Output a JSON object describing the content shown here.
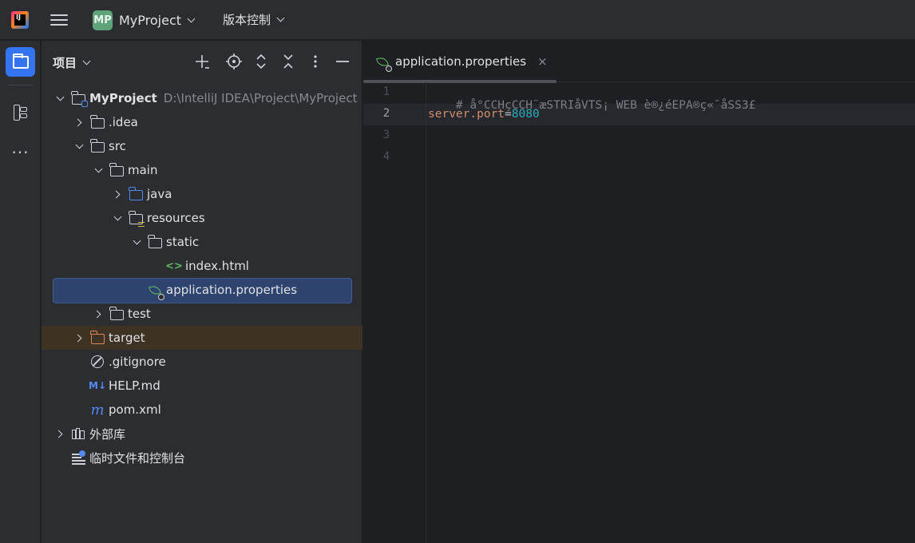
{
  "titlebar": {
    "project_badge": "MP",
    "project_name": "MyProject",
    "vcs_label": "版本控制"
  },
  "activity_bar": {
    "items": [
      {
        "icon": "folder-icon",
        "active": true
      },
      {
        "icon": "structure-icon",
        "active": false
      },
      {
        "icon": "more-icon",
        "active": false
      }
    ]
  },
  "panel": {
    "title": "项目",
    "tree": [
      {
        "label": "MyProject",
        "path": "D:\\IntelliJ IDEA\\Project\\MyProject",
        "depth": 0
      },
      {
        "label": ".idea",
        "depth": 1
      },
      {
        "label": "src",
        "depth": 1
      },
      {
        "label": "main",
        "depth": 2
      },
      {
        "label": "java",
        "depth": 3
      },
      {
        "label": "resources",
        "depth": 3
      },
      {
        "label": "static",
        "depth": 4
      },
      {
        "label": "index.html",
        "depth": 5
      },
      {
        "label": "application.properties",
        "depth": 4,
        "selected": true
      },
      {
        "label": "test",
        "depth": 2
      },
      {
        "label": "target",
        "depth": 1
      },
      {
        "label": ".gitignore",
        "depth": 1
      },
      {
        "label": "HELP.md",
        "depth": 1
      },
      {
        "label": "pom.xml",
        "depth": 1
      },
      {
        "label": "外部库",
        "depth": 0
      },
      {
        "label": "临时文件和控制台",
        "depth": 0
      }
    ]
  },
  "editor": {
    "tab": {
      "label": "application.properties",
      "close": "×"
    },
    "line_numbers": [
      "1",
      "2",
      "3",
      "4"
    ],
    "current_line": 2,
    "lines": {
      "l1_comment": "# å°CCHçCCH¨æSTRIåVTS¡ WEB è®¿éEPA®ç«¯åSS3£",
      "l2_key": "server.port",
      "l2_eq": "=",
      "l2_value": "8080"
    }
  },
  "colors": {
    "accent": "#3574f0",
    "selection": "#2e436e",
    "excluded_row": "#3d3223",
    "property_key": "#cf8e6d",
    "property_value": "#2aacb8",
    "comment": "#7a7e85"
  }
}
